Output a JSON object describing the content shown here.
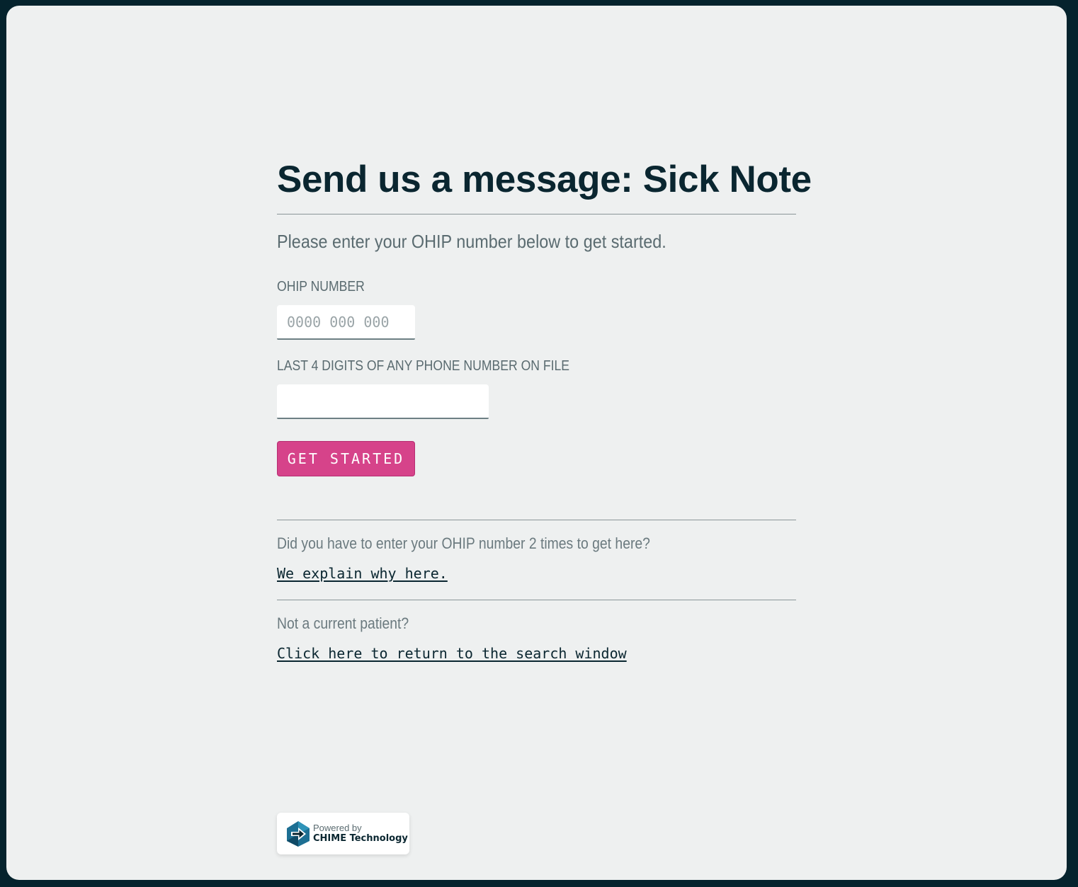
{
  "page": {
    "title": "Send us a message: Sick Note",
    "intro": "Please enter your OHIP number below to get started."
  },
  "form": {
    "ohip_label": "OHIP NUMBER",
    "ohip_placeholder": "0000 000 000",
    "ohip_value": "",
    "phone_label": "LAST 4 DIGITS OF ANY PHONE NUMBER ON FILE",
    "phone_value": "",
    "submit_label": "GET STARTED"
  },
  "help": {
    "ohip_question": "Did you have to enter your OHIP number 2 times to get here?",
    "ohip_link": "We explain why here.",
    "patient_question": "Not a current patient?",
    "patient_link": "Click here to return to the search window"
  },
  "footer": {
    "powered_by": "Powered by",
    "brand": "CHIME Technology",
    "logo_icon": "chime-logo-icon"
  },
  "colors": {
    "background": "#05232d",
    "card": "#eef0f0",
    "accent": "#d6438a",
    "heading": "#0a2630"
  }
}
